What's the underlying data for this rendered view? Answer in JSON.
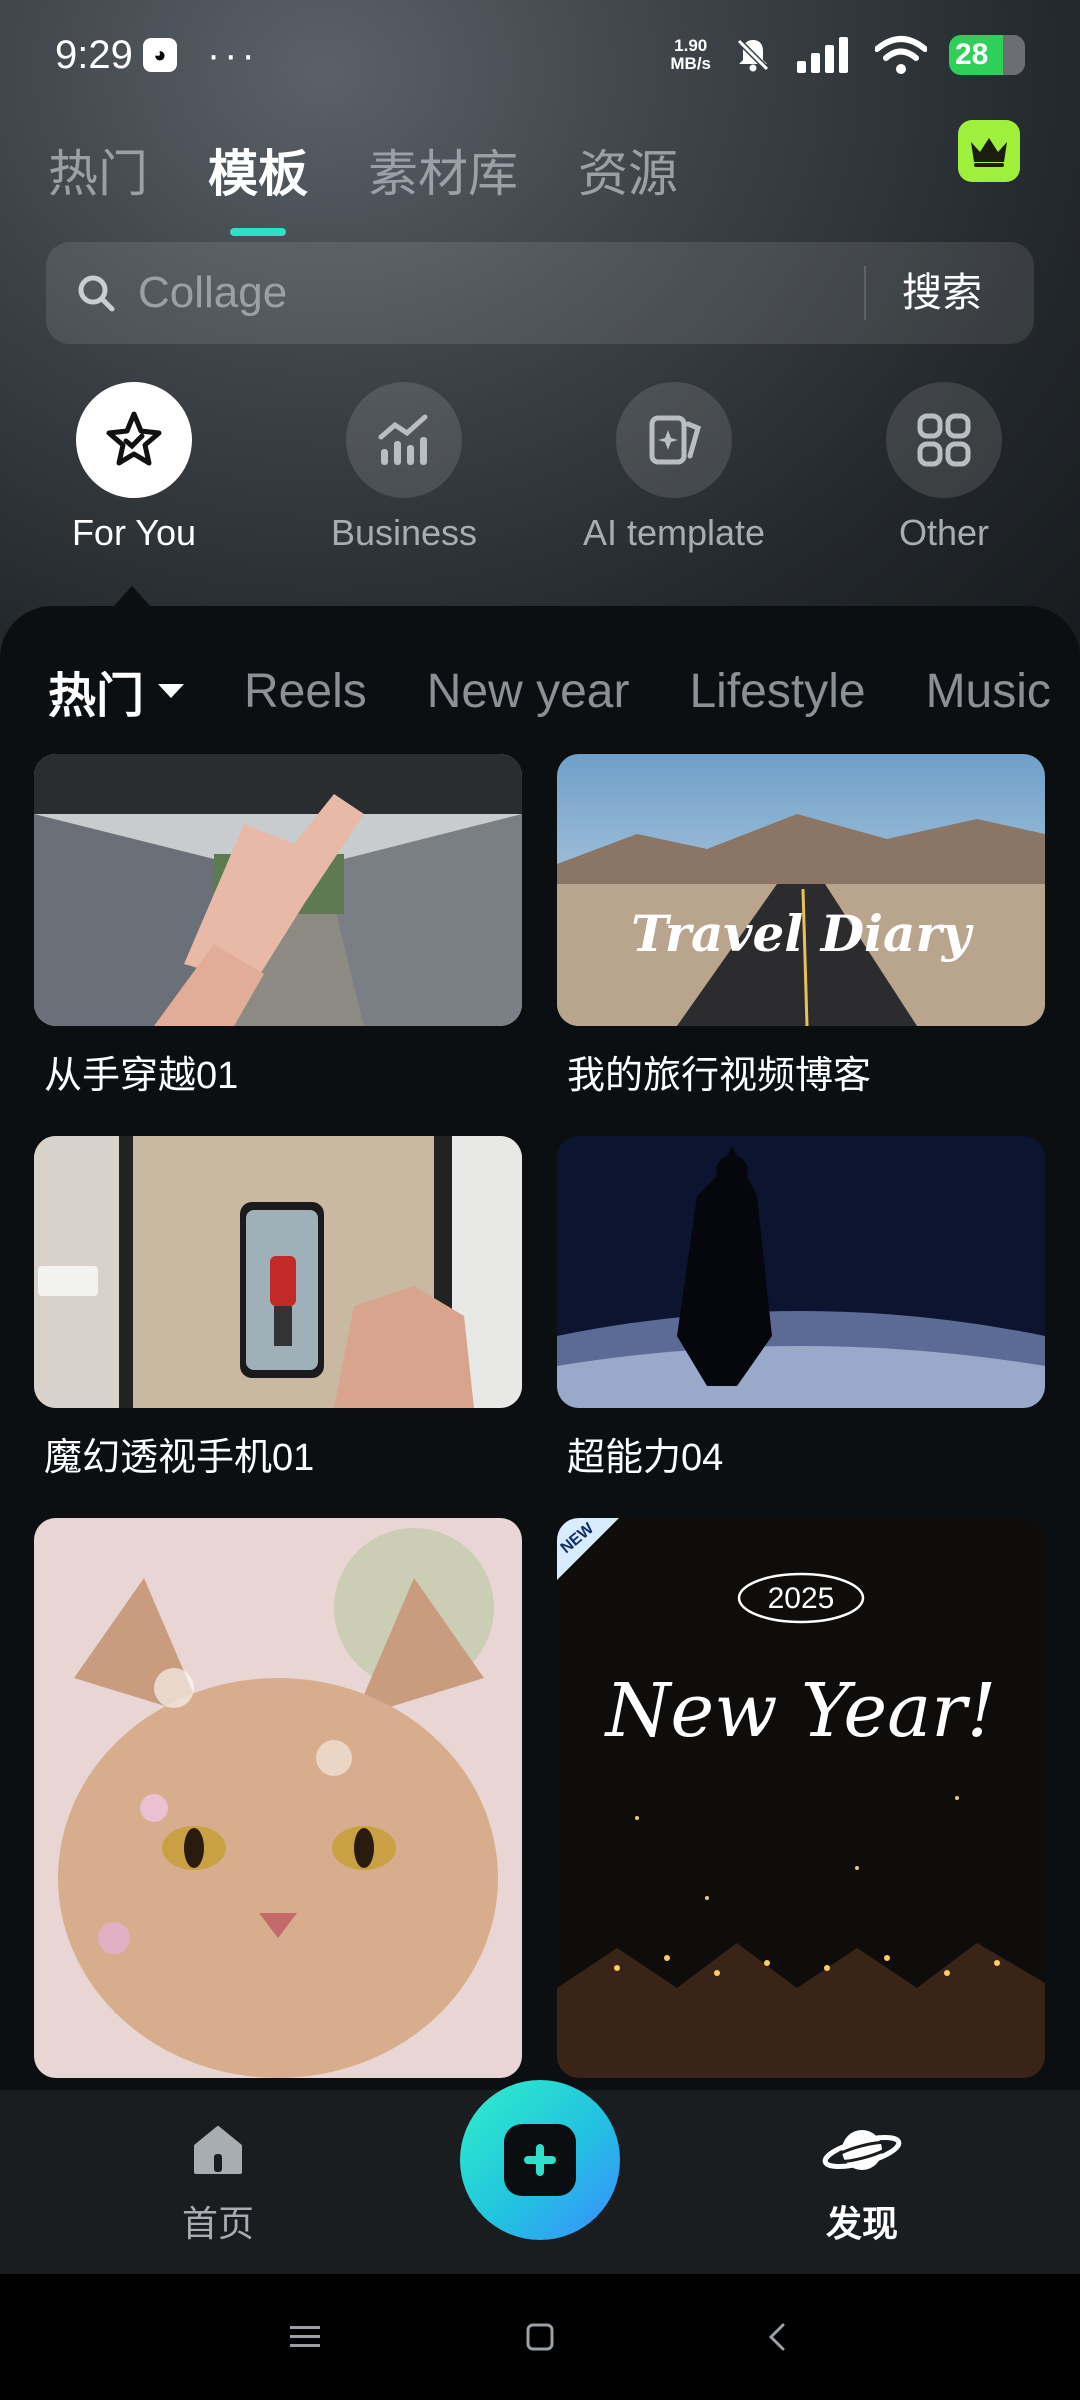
{
  "status_bar": {
    "time": "9:29",
    "dots": "···",
    "net_speed_top": "1.90",
    "net_speed_bottom": "MB/s",
    "battery": "28"
  },
  "top_tabs": [
    {
      "label": "热门",
      "active": false
    },
    {
      "label": "模板",
      "active": true
    },
    {
      "label": "素材库",
      "active": false
    },
    {
      "label": "资源",
      "active": false
    }
  ],
  "search": {
    "placeholder": "Collage",
    "button": "搜索"
  },
  "categories": [
    {
      "label": "For You",
      "icon": "star-badge-icon",
      "active": true
    },
    {
      "label": "Business",
      "icon": "chart-icon",
      "active": false
    },
    {
      "label": "AI template",
      "icon": "ai-cards-icon",
      "active": false
    },
    {
      "label": "Other",
      "icon": "grid-icon",
      "active": false
    }
  ],
  "sub_tabs": [
    {
      "label": "热门",
      "active": true
    },
    {
      "label": "Reels",
      "active": false
    },
    {
      "label": "New year",
      "active": false
    },
    {
      "label": "Lifestyle",
      "active": false
    },
    {
      "label": "Music",
      "active": false
    }
  ],
  "templates": [
    {
      "title": "从手穿越01",
      "overlay": ""
    },
    {
      "title": "我的旅行视频博客",
      "overlay": "Travel Diary"
    },
    {
      "title": "魔幻透视手机01",
      "overlay": ""
    },
    {
      "title": "超能力04",
      "overlay": ""
    },
    {
      "title": "",
      "overlay": ""
    },
    {
      "title": "",
      "overlay": "New Year!",
      "badge": "NEW",
      "year": "2025"
    }
  ],
  "bottom_nav": {
    "home": "首页",
    "discover": "发现"
  },
  "colors": {
    "accent": "#2fe0c8",
    "crown": "#9ef03a",
    "battery": "#2fd05a"
  }
}
